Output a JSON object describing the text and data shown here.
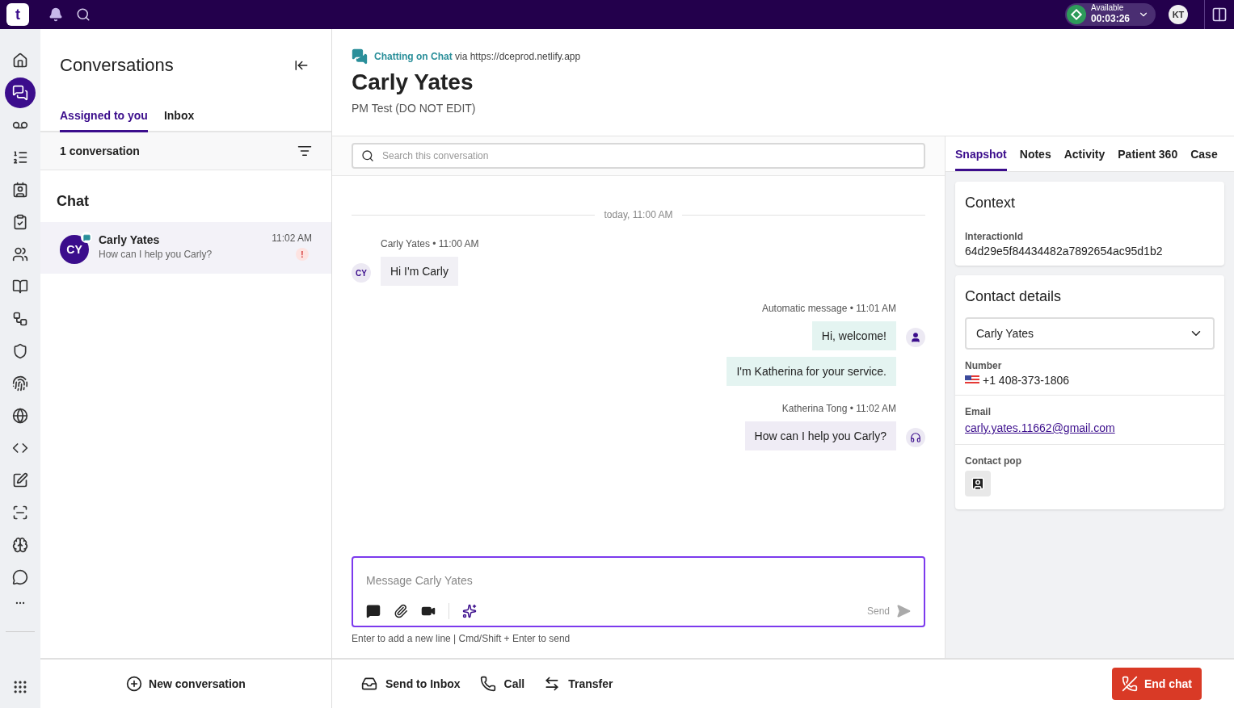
{
  "top_bar": {
    "logo": "t",
    "status": {
      "label": "Available",
      "timer": "00:03:26"
    },
    "user_initials": "KT"
  },
  "rail": [
    {
      "selected": false
    },
    {
      "selected": true
    },
    {
      "selected": false
    },
    {
      "selected": false
    },
    {
      "selected": false
    },
    {
      "selected": false
    },
    {
      "selected": false
    },
    {
      "selected": false
    },
    {
      "selected": false
    },
    {
      "selected": false
    },
    {
      "selected": false
    },
    {
      "selected": false
    },
    {
      "selected": false
    },
    {
      "selected": false
    },
    {
      "selected": false
    },
    {
      "selected": false
    },
    {
      "selected": false
    }
  ],
  "conversations": {
    "title": "Conversations",
    "tabs": [
      {
        "label": "Assigned to you",
        "selected": true
      },
      {
        "label": "Inbox",
        "selected": false
      }
    ],
    "count": "1 conversation",
    "section": "Chat",
    "items": [
      {
        "initials": "CY",
        "name": "Carly Yates",
        "preview": "How can I help you Carly?",
        "time": "11:02 AM",
        "selected": true,
        "alert": "!"
      }
    ],
    "new_button": "New conversation"
  },
  "chat": {
    "channel": "Chatting on Chat",
    "via": "via https://dceprod.netlify.app",
    "name": "Carly Yates",
    "subtitle": "PM Test (DO NOT EDIT)",
    "search": {
      "placeholder": "Search this conversation"
    },
    "date_divider": "today, 11:00 AM",
    "messages": [
      {
        "kind": "contact",
        "header": "Carly Yates • 11:00 AM",
        "avatar": "CY",
        "bubbles": [
          "Hi I'm Carly"
        ]
      },
      {
        "kind": "automatic",
        "header": "Automatic message • 11:01 AM",
        "bubbles": [
          "Hi, welcome!",
          "I'm Katherina for your service."
        ]
      },
      {
        "kind": "agent",
        "header": "Katherina Tong • 11:02 AM",
        "bubbles": [
          "How can I help you Carly?"
        ]
      }
    ],
    "composer": {
      "placeholder": "Message Carly Yates",
      "send": "Send",
      "hint": "Enter to add a new line | Cmd/Shift + Enter to send"
    },
    "actions": [
      "Send to Inbox",
      "Call",
      "Transfer"
    ],
    "end_button": "End chat"
  },
  "details": {
    "tabs": [
      {
        "label": "Snapshot",
        "selected": true
      },
      {
        "label": "Notes",
        "selected": false
      },
      {
        "label": "Activity",
        "selected": false
      },
      {
        "label": "Patient 360",
        "selected": false
      },
      {
        "label": "Case",
        "selected": false
      }
    ],
    "context": {
      "title": "Context",
      "label": "InteractionId",
      "value": "64d29e5f84434482a7892654ac95d1b2"
    },
    "contact": {
      "title": "Contact details",
      "selected_contact": "Carly Yates",
      "number_label": "Number",
      "number": "+1 408-373-1806",
      "email_label": "Email",
      "email": "carly.yates.11662@gmail.com",
      "pop_label": "Contact pop"
    }
  }
}
